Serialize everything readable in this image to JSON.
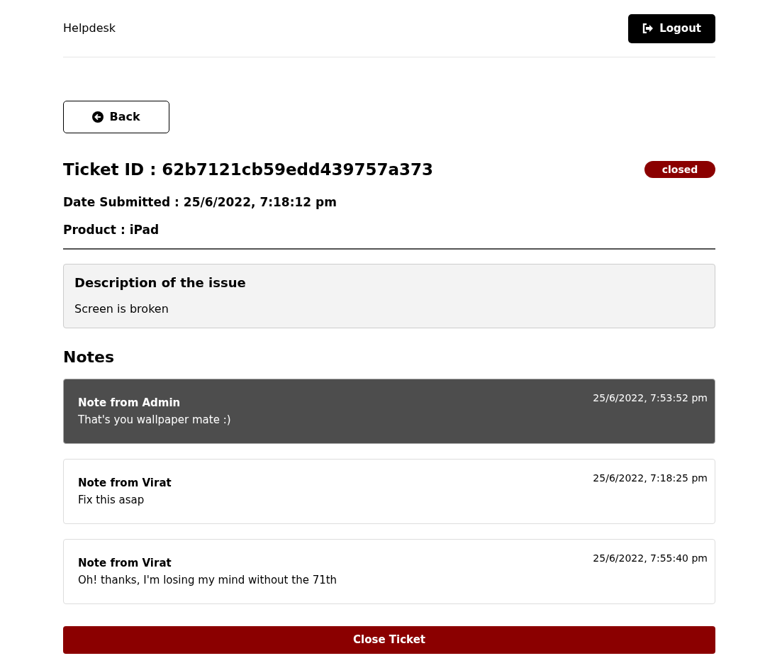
{
  "header": {
    "brand": "Helpdesk",
    "logout": "Logout"
  },
  "back": "Back",
  "ticket": {
    "id_line": "Ticket ID : 62b7121cb59edd439757a373",
    "status": "closed",
    "date_line": "Date Submitted : 25/6/2022, 7:18:12 pm",
    "product_line": "Product : iPad"
  },
  "description": {
    "title": "Description of the issue",
    "text": "Screen is broken"
  },
  "notes_title": "Notes",
  "notes": [
    {
      "author": "Note from Admin",
      "text": "That's you wallpaper mate :)",
      "time": "25/6/2022, 7:53:52 pm",
      "staff": true
    },
    {
      "author": "Note from Virat",
      "text": "Fix this asap",
      "time": "25/6/2022, 7:18:25 pm",
      "staff": false
    },
    {
      "author": "Note from Virat",
      "text": "Oh! thanks, I'm losing my mind without the 71th",
      "time": "25/6/2022, 7:55:40 pm",
      "staff": false
    }
  ],
  "close_button": "Close Ticket"
}
